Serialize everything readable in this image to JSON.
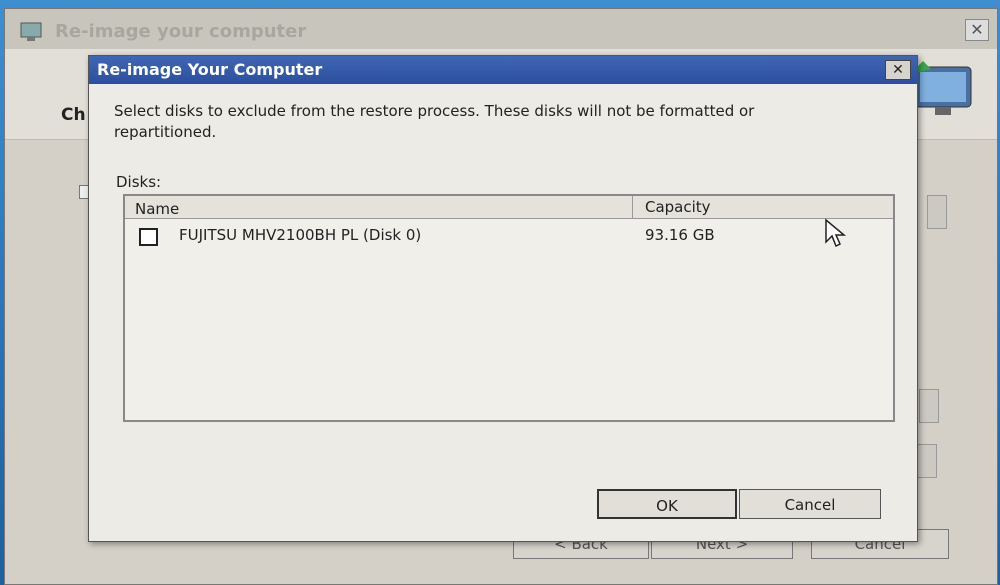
{
  "outer_window": {
    "title": "Re-image your computer",
    "heading": "Ch",
    "back_label": "< Back",
    "next_label": "Next >",
    "cancel_label": "Cancel"
  },
  "dialog": {
    "title": "Re-image Your Computer",
    "close_label": "✕",
    "instruction": "Select disks to exclude from the restore process. These disks will not be formatted or repartitioned.",
    "disks_label": "Disks:",
    "columns": {
      "name": "Name",
      "capacity": "Capacity"
    },
    "disks": [
      {
        "name": "FUJITSU MHV2100BH PL (Disk 0)",
        "capacity": "93.16 GB",
        "checked": false
      }
    ],
    "ok_label": "OK",
    "cancel_label": "Cancel"
  },
  "colors": {
    "titlebar": "#2b4f9e",
    "dialog_bg": "#ecebe5",
    "desktop": "#2a76bd"
  }
}
